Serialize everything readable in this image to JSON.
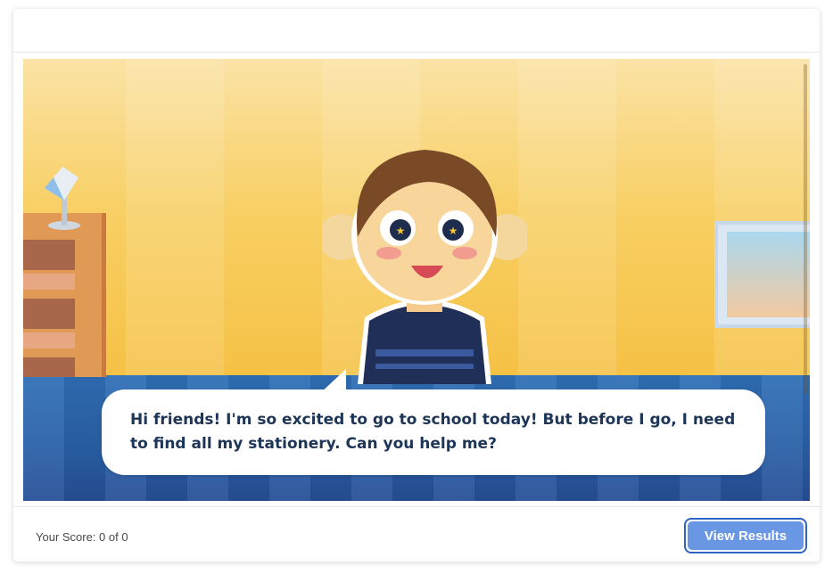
{
  "dialogue": {
    "text": "Hi friends! I'm so excited to go to school today! But before I go, I need to find all my stationery. Can you help me?"
  },
  "footer": {
    "score_text": "Your Score: 0 of 0",
    "view_results_label": "View Results"
  },
  "colors": {
    "wall": "#f8cf63",
    "floor": "#2a5fa6",
    "button": "#6a97e3",
    "button_border": "#2f64c2",
    "dialogue_text": "#1d3557"
  },
  "icons": {
    "lamp": "desk-lamp-icon",
    "frame": "picture-frame-icon"
  }
}
